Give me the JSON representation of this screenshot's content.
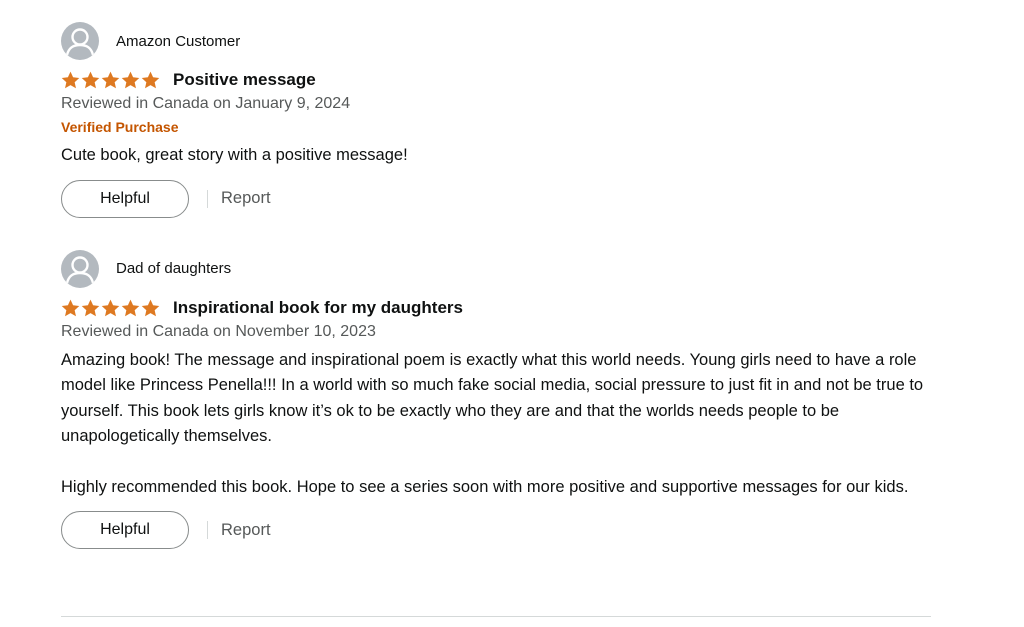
{
  "colors": {
    "star": "#de7921",
    "verified": "#c45500",
    "secondary_text": "#565959",
    "primary_text": "#0f1111",
    "avatar_bg": "#b3b9bf"
  },
  "reviews": [
    {
      "profile_name": "Amazon Customer",
      "rating": 5,
      "title": "Positive message",
      "date": "Reviewed in Canada on January 9, 2024",
      "verified": "Verified Purchase",
      "body": [
        "Cute book, great story with a positive message!"
      ],
      "helpful_label": "Helpful",
      "report_label": "Report"
    },
    {
      "profile_name": "Dad of daughters",
      "rating": 5,
      "title": "Inspirational book for my daughters",
      "date": "Reviewed in Canada on November 10, 2023",
      "body": [
        "Amazing book! The message and inspirational poem is exactly what this world needs. Young girls need to have a role model like Princess Penella!!! In a world with so much fake social media, social pressure to just fit in and not be true to yourself. This book lets girls know it’s ok to be exactly who they are and that the worlds needs people to be unapologetically themselves.",
        "Highly recommended this book. Hope to see a series soon with more positive and supportive messages for our kids."
      ],
      "helpful_label": "Helpful",
      "report_label": "Report"
    }
  ]
}
